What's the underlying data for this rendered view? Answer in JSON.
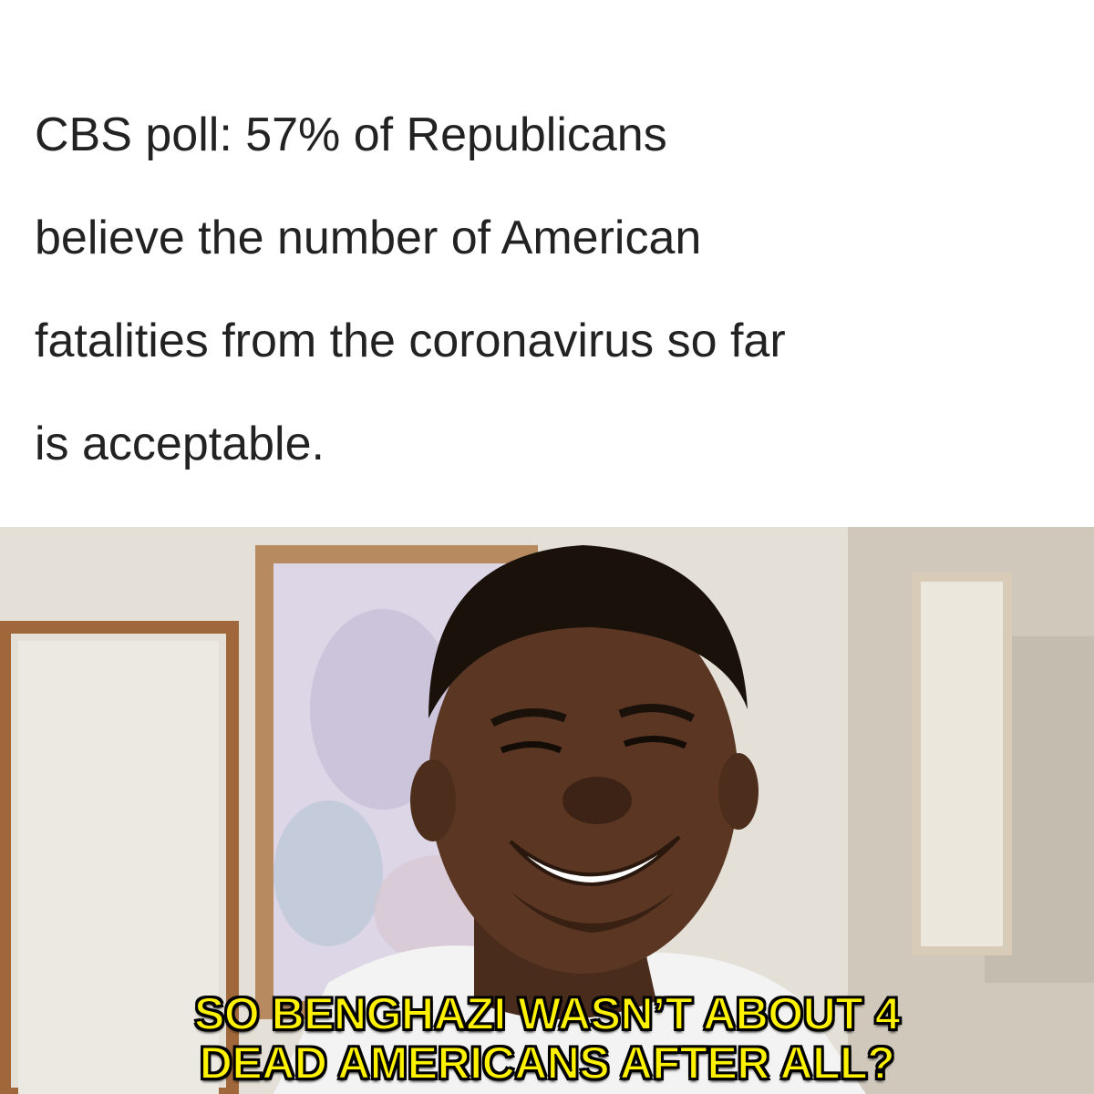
{
  "headline": {
    "lines": [
      "CBS poll: 57% of Republicans",
      "believe the number of American",
      "fatalities from the coronavirus so far",
      "is acceptable."
    ]
  },
  "photo": {
    "description_icon": "meme-reaction-photo"
  },
  "caption": {
    "lines": [
      "SO BENGHAZI WASN’T ABOUT 4",
      "DEAD AMERICANS AFTER ALL?"
    ],
    "color": "#fff200",
    "outline_color": "#000000"
  }
}
